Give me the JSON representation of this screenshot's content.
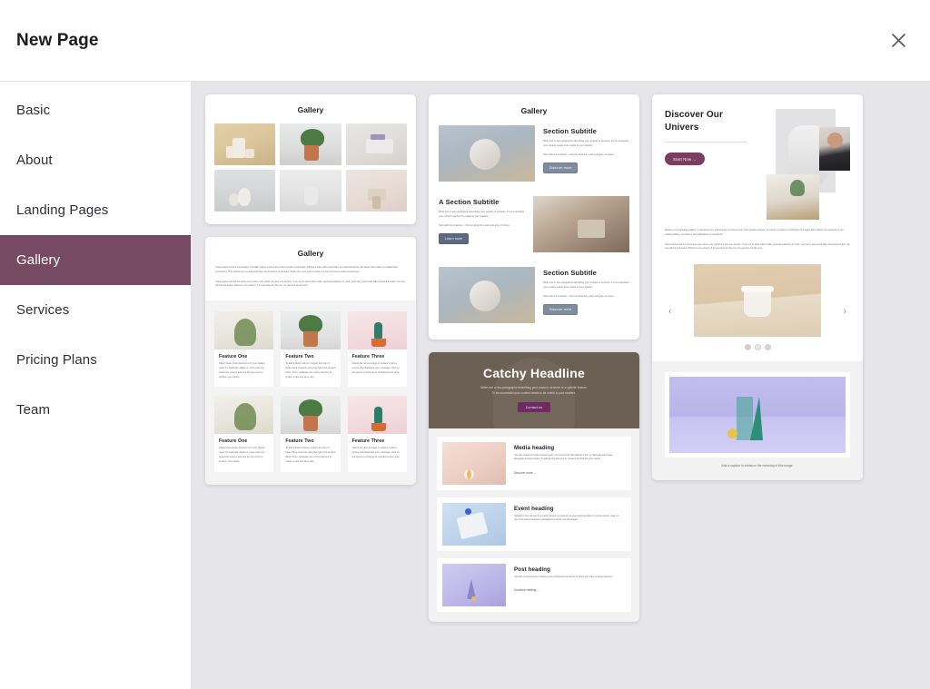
{
  "header": {
    "title": "New Page",
    "close_label": "Close"
  },
  "sidebar": {
    "items": [
      {
        "label": "Basic",
        "active": false
      },
      {
        "label": "About",
        "active": false
      },
      {
        "label": "Landing Pages",
        "active": false
      },
      {
        "label": "Gallery",
        "active": true
      },
      {
        "label": "Services",
        "active": false
      },
      {
        "label": "Pricing Plans",
        "active": false
      },
      {
        "label": "Team",
        "active": false
      }
    ]
  },
  "colors": {
    "accent_purple": "#764a62",
    "canvas_bg": "#e6e6ea",
    "hero_brown": "#6c6055",
    "hero_button": "#6d2a63"
  },
  "templates": {
    "gallery_grid": {
      "title": "Gallery",
      "images": [
        "beige-vases-photo",
        "plant-in-copper-pot-photo",
        "lavender-on-block-photo",
        "white-pears-photo",
        "white-speaker-photo",
        "stone-sculpture-photo"
      ]
    },
    "gallery_features": {
      "title": "Gallery",
      "paragraph_1": "Great stories have a personality. Consider telling a great story that provides personality. Writing a story with personality for potential clients will assist with making a relationship connection. This shows up in small quirks like word choices or phrases. Write from your point of view, not from someone else's experience.",
      "paragraph_2": "Great stories are for everyone even when only written for just one person. If you try to write with a wide, general audience in mind, your story will sound fake and lack emotion. No one will be interested. Write for one person. If it's genuine for the one, it's genuine for the rest.",
      "features": [
        {
          "title": "Feature One",
          "body": "Adapt these three columns to fit your design need. To duplicate, delete or move columns, select the column and use the top icons to perform your action.",
          "image": "ivy-plant-photo"
        },
        {
          "title": "Feature Two",
          "body": "To add a fourth column, reduce the size of these three columns using the right icon of each block. Then, duplicate one of the columns to create a new one as a copy.",
          "image": "potted-plant-photo"
        },
        {
          "title": "Feature Three",
          "body": "Delete the above image or replace it with a picture that illustrates your message. Click on the picture to change its rounded corner style.",
          "image": "cactus-pink-photo"
        }
      ]
    },
    "sections": {
      "title": "Gallery",
      "blocks": [
        {
          "heading": "Section Subtitle",
          "body_1": "Write one or two paragraphs describing your product or services. To be successful your content needs to be useful to your readers.",
          "body_2": "Start with the customer – find out what they want and give it to them.",
          "button": "Discover more",
          "image": "stone-ball-photo",
          "layout": "image-left"
        },
        {
          "heading": "A Section Subtitle",
          "body_1": "Write one or two paragraphs describing your product or services. To be successful your content needs to be useful to your readers.",
          "body_2": "Start with the customer – find out what they want and give it to them.",
          "button": "Learn more",
          "image": "woven-basket-photo",
          "layout": "image-right"
        },
        {
          "heading": "Section Subtitle",
          "body_1": "Write one or two paragraphs describing your product or services. To be successful your content needs to be useful to your readers.",
          "body_2": "Start with the customer – find out what they want and give it to them.",
          "button": "Discover more",
          "image": "stone-ball-photo",
          "layout": "image-left"
        }
      ]
    },
    "hero_media": {
      "hero": {
        "headline": "Catchy Headline",
        "sub_1": "Write one or two paragraphs describing your product, services or a specific feature.",
        "sub_2": "To be successful your content needs to be useful to your readers.",
        "button": "Contact us"
      },
      "items": [
        {
          "title": "Media heading",
          "body": "Use this snippet to build various types of components that feature a left- or right-aligned image alongside textual content. Duplicate the element to create a list that fits your needs.",
          "link": "Discover more →",
          "image": "beach-ball-peach-photo"
        },
        {
          "title": "Event heading",
          "body": "Speakers from all over the world will join our experts to give inspiring talks on various topics. Stay on top of the latest business management trends & technologies.",
          "link": "",
          "image": "blue-abstract-photo"
        },
        {
          "title": "Post heading",
          "body": "Use this component for creating a list of featured elements to which you want to bring attention.",
          "link": "Continue reading →",
          "image": "violet-cone-photo"
        }
      ]
    },
    "discover": {
      "headline": "Discover Our Univers",
      "button": "Start Now  →",
      "paragraph_1": "Explore our captivating gallery, a visual journey showcasing our finest work and creative projects. Immerse yourself in a collection of images that capture the essence of our craftsmanship, innovation, and dedication to excellence.",
      "paragraph_2": "Great stories are for everyone even when only written for just one person. If you try to write with a wide, general audience in mind, your story will sound fake and lack emotion. No one will be interested. Write for one person. If it's genuine for the one, it's genuine for the rest.",
      "carousel": {
        "prev": "‹",
        "next": "›",
        "slides": 3,
        "active_slide": 1,
        "image": "cream-cup-photo"
      },
      "caption": "Add a caption to enhance the meaning of this image.",
      "caption_image": "green-prism-violet-photo"
    }
  }
}
